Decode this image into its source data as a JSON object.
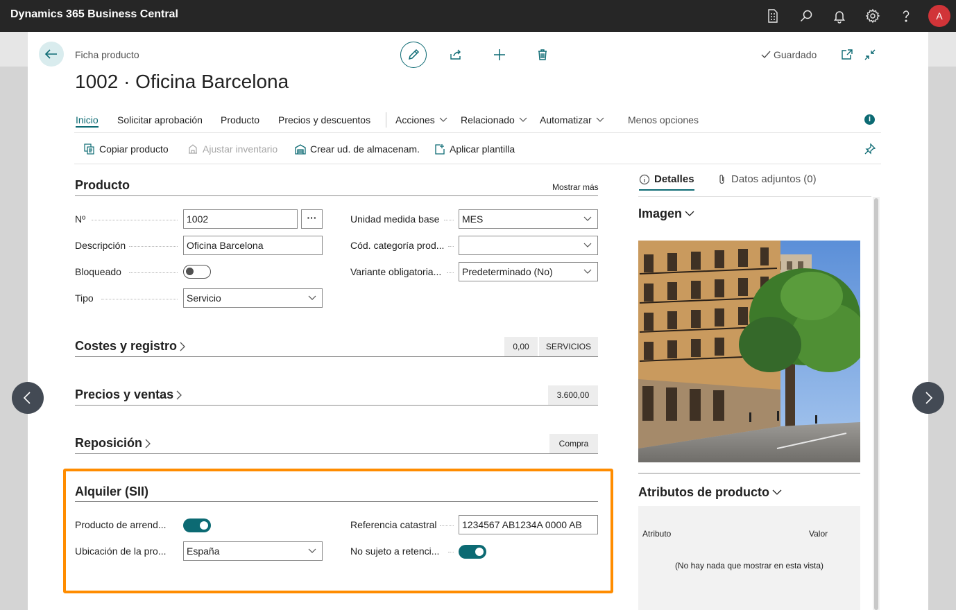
{
  "app": {
    "title": "Dynamics 365 Business Central",
    "avatar_initial": "A"
  },
  "header": {
    "caption": "Ficha producto",
    "title": "1002 · Oficina Barcelona",
    "saved_label": "Guardado"
  },
  "nav": {
    "tabs": [
      "Inicio",
      "Solicitar aprobación",
      "Producto",
      "Precios y descuentos"
    ],
    "menus": [
      "Acciones",
      "Relacionado",
      "Automatizar"
    ],
    "less_options": "Menos opciones"
  },
  "actions": {
    "copy": "Copiar producto",
    "adjust": "Ajustar inventario",
    "create_sku": "Crear ud. de almacenam.",
    "apply_template": "Aplicar plantilla"
  },
  "producto": {
    "title": "Producto",
    "show_more": "Mostrar más",
    "no_label": "Nº",
    "no_value": "1002",
    "desc_label": "Descripción",
    "desc_value": "Oficina Barcelona",
    "blocked_label": "Bloqueado",
    "blocked": false,
    "tipo_label": "Tipo",
    "tipo_value": "Servicio",
    "uom_label": "Unidad medida base",
    "uom_value": "MES",
    "cat_label": "Cód. categoría prod...",
    "cat_value": "",
    "variant_label": "Variante obligatoria...",
    "variant_value": "Predeterminado (No)"
  },
  "costes": {
    "title": "Costes y registro",
    "badge1": "0,00",
    "badge2": "SERVICIOS"
  },
  "precios": {
    "title": "Precios y ventas",
    "badge": "3.600,00"
  },
  "reposicion": {
    "title": "Reposición",
    "badge": "Compra"
  },
  "alquiler": {
    "title": "Alquiler (SII)",
    "arrend_label": "Producto de arrend...",
    "arrend": true,
    "ubic_label": "Ubicación de la pro...",
    "ubic_value": "España",
    "ref_label": "Referencia catastral",
    "ref_value": "1234567 AB1234A 0000 AB",
    "nosujeto_label": "No sujeto a retenci...",
    "nosujeto": true
  },
  "factbox": {
    "tab_details": "Detalles",
    "tab_attachments": "Datos adjuntos (0)",
    "image_title": "Imagen",
    "attr_title": "Atributos de producto",
    "attr_col1": "Atributo",
    "attr_col2": "Valor",
    "attr_empty": "(No hay nada que mostrar en esta vista)"
  },
  "colors": {
    "accent": "#0c6a73",
    "highlight": "#ff8c00",
    "topbar": "#262626",
    "avatar": "#d13438"
  }
}
